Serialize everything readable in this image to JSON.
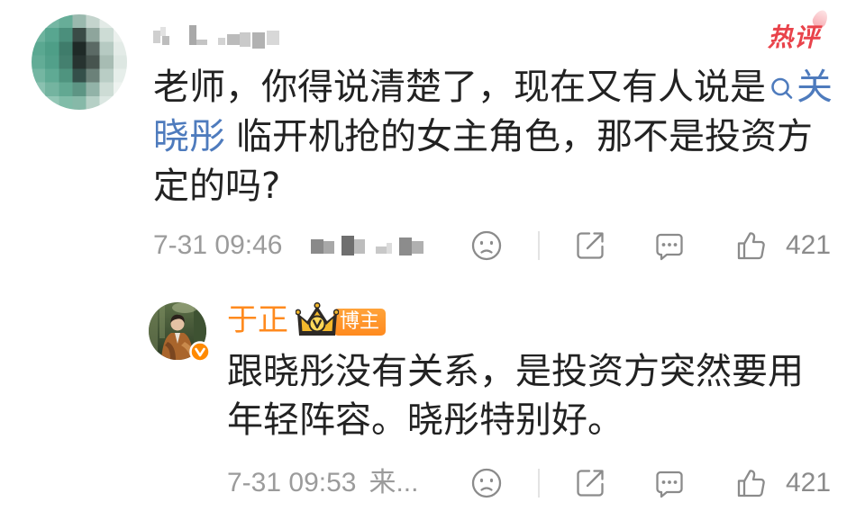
{
  "colors": {
    "body_text": "#222222",
    "topic_link": "#4e7bbd",
    "meta_text": "#9b9b9b",
    "action_icon": "#8b8b8b",
    "divider": "#e3e3e3",
    "author_name": "#ff8a1e",
    "host_badge": "#ff8a1e",
    "hot_badge": "#e9434b"
  },
  "action_icons": [
    "reaction-face-icon",
    "share-icon",
    "comment-icon",
    "like-icon"
  ],
  "comment": {
    "hot_badge": "热评",
    "body": {
      "line1": "老师，你得说清楚了，现在又有人说是",
      "link_part1": "关",
      "link_part2": "晓彤",
      "line2": "临开机抢的女主角色，那不是投资方",
      "line3": "定的吗?"
    },
    "timestamp": "7-31 09:46",
    "like_count": "421"
  },
  "reply": {
    "author": "于正",
    "host_badge": "博主",
    "body": {
      "line1": "跟晓彤没有关系，是投资方突然要用",
      "line2": "年轻阵容。晓彤特别好。"
    },
    "timestamp": "7-31 09:53",
    "location": "来...",
    "like_count": "421"
  }
}
